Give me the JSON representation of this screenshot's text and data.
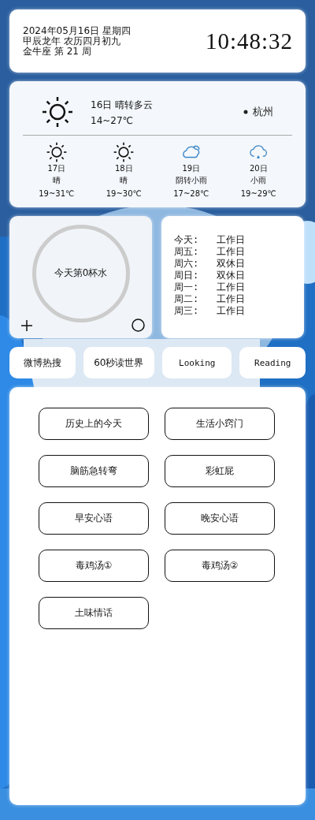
{
  "date_card": {
    "lines": [
      "2024年05月16日 星期四",
      "甲辰龙年 农历四月初九",
      "金牛座 第 21 周"
    ],
    "time": "10:48:32"
  },
  "weather": {
    "today": {
      "kind": "sunny",
      "title": "16日 晴转多云",
      "temp": "14~27℃"
    },
    "city": "杭州",
    "forecast": [
      {
        "kind": "sunny",
        "day": "17日",
        "desc": "晴",
        "temp": "19~31℃"
      },
      {
        "kind": "sunny",
        "day": "18日",
        "desc": "晴",
        "temp": "19~30℃"
      },
      {
        "kind": "cloudy",
        "day": "19日",
        "desc": "阴转小雨",
        "temp": "17~28℃"
      },
      {
        "kind": "rain",
        "day": "20日",
        "desc": "小雨",
        "temp": "19~29℃"
      }
    ]
  },
  "water": {
    "label": "今天第0杯水"
  },
  "holidays": [
    {
      "day": "今天:",
      "type": "工作日"
    },
    {
      "day": "周五:",
      "type": "工作日"
    },
    {
      "day": "周六:",
      "type": "双休日"
    },
    {
      "day": "周日:",
      "type": "双休日"
    },
    {
      "day": "周一:",
      "type": "工作日"
    },
    {
      "day": "周二:",
      "type": "工作日"
    },
    {
      "day": "周三:",
      "type": "工作日"
    }
  ],
  "tabs": [
    "微博热搜",
    "60秒读世界",
    "Looking",
    "Reading"
  ],
  "buttons": [
    "历史上的今天",
    "生活小窍门",
    "脑筋急转弯",
    "彩虹屁",
    "早安心语",
    "晚安心语",
    "毒鸡汤①",
    "毒鸡汤②",
    "土味情话"
  ]
}
